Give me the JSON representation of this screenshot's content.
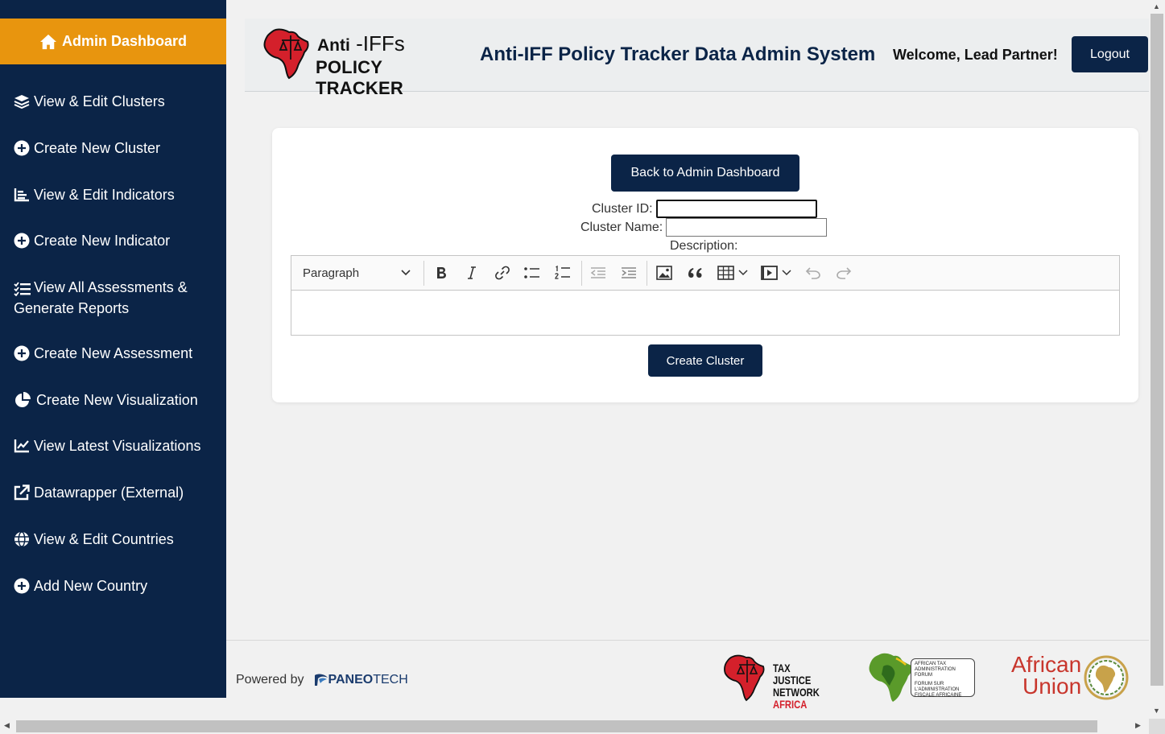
{
  "sidebar": {
    "active_label": "Admin Dashboard",
    "items": [
      {
        "label": "View & Edit Clusters",
        "icon": "layers-icon"
      },
      {
        "label": "Create New Cluster",
        "icon": "plus-circle-icon"
      },
      {
        "label": "View & Edit Indicators",
        "icon": "chart-bar-icon"
      },
      {
        "label": "Create New Indicator",
        "icon": "plus-circle-icon"
      },
      {
        "label": "View All Assessments & Generate Reports",
        "icon": "list-check-icon"
      },
      {
        "label": "Create New Assessment",
        "icon": "plus-circle-icon"
      },
      {
        "label": "Create New Visualization",
        "icon": "pie-chart-icon"
      },
      {
        "label": "View Latest Visualizations",
        "icon": "line-chart-icon"
      },
      {
        "label": "Datawrapper (External)",
        "icon": "external-link-icon"
      },
      {
        "label": "View & Edit Countries",
        "icon": "globe-icon"
      },
      {
        "label": "Add New Country",
        "icon": "plus-circle-icon"
      }
    ],
    "multiline": {
      "line1": "View All Assessments &",
      "line2": "Generate Reports"
    }
  },
  "header": {
    "logo_anti": "Anti",
    "logo_iffs": "-IFFs",
    "logo_line2": "POLICY TRACKER",
    "title": "Anti-IFF Policy Tracker Data Admin System",
    "welcome": "Welcome, Lead Partner!",
    "logout_label": "Logout"
  },
  "form": {
    "back_label": "Back to Admin Dashboard",
    "cluster_id_label": "Cluster ID:",
    "cluster_id_value": "",
    "cluster_name_label": "Cluster Name:",
    "cluster_name_value": "",
    "description_label": "Description:",
    "heading_option": "Paragraph",
    "submit_label": "Create Cluster"
  },
  "footer": {
    "powered_by": "Powered by",
    "paneo": "PANEO",
    "tech": "TECH",
    "partners": {
      "tjna": [
        "TAX JUSTICE",
        "NETWORK",
        "AFRICA"
      ],
      "ataf": [
        "AFRICAN TAX",
        "ADMINISTRATION FORUM",
        "FORUM SUR",
        "L'ADMINISTRATION",
        "FISCALE AFRICAINE"
      ],
      "au": [
        "African",
        "Union"
      ]
    }
  },
  "colors": {
    "navy": "#0b2447",
    "accent": "#e8950e",
    "africa_red": "#d4202b"
  }
}
